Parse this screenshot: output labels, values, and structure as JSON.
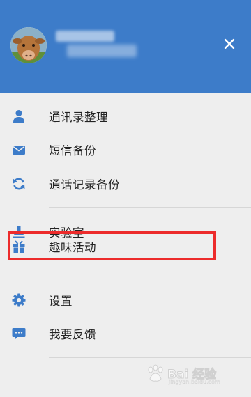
{
  "header": {
    "background_color": "#3d7cc9",
    "avatar_icon": "user-avatar-cow",
    "close_icon": "close-icon"
  },
  "menu": {
    "items": [
      {
        "label": "通讯录整理",
        "icon": "person-icon"
      },
      {
        "label": "短信备份",
        "icon": "envelope-icon"
      },
      {
        "label": "通话记录备份",
        "icon": "sync-icon"
      },
      {
        "label": "实验室",
        "icon": "flask-icon"
      },
      {
        "label": "趣味活动",
        "icon": "gift-icon"
      },
      {
        "label": "设置",
        "icon": "gear-icon"
      },
      {
        "label": "我要反馈",
        "icon": "chat-bubble-icon"
      }
    ],
    "icon_color": "#3d7cc9",
    "highlight_color": "#ec2b2b"
  },
  "watermark": {
    "title": "Bai 经验",
    "subtitle": "jingyan.baidu.com"
  }
}
